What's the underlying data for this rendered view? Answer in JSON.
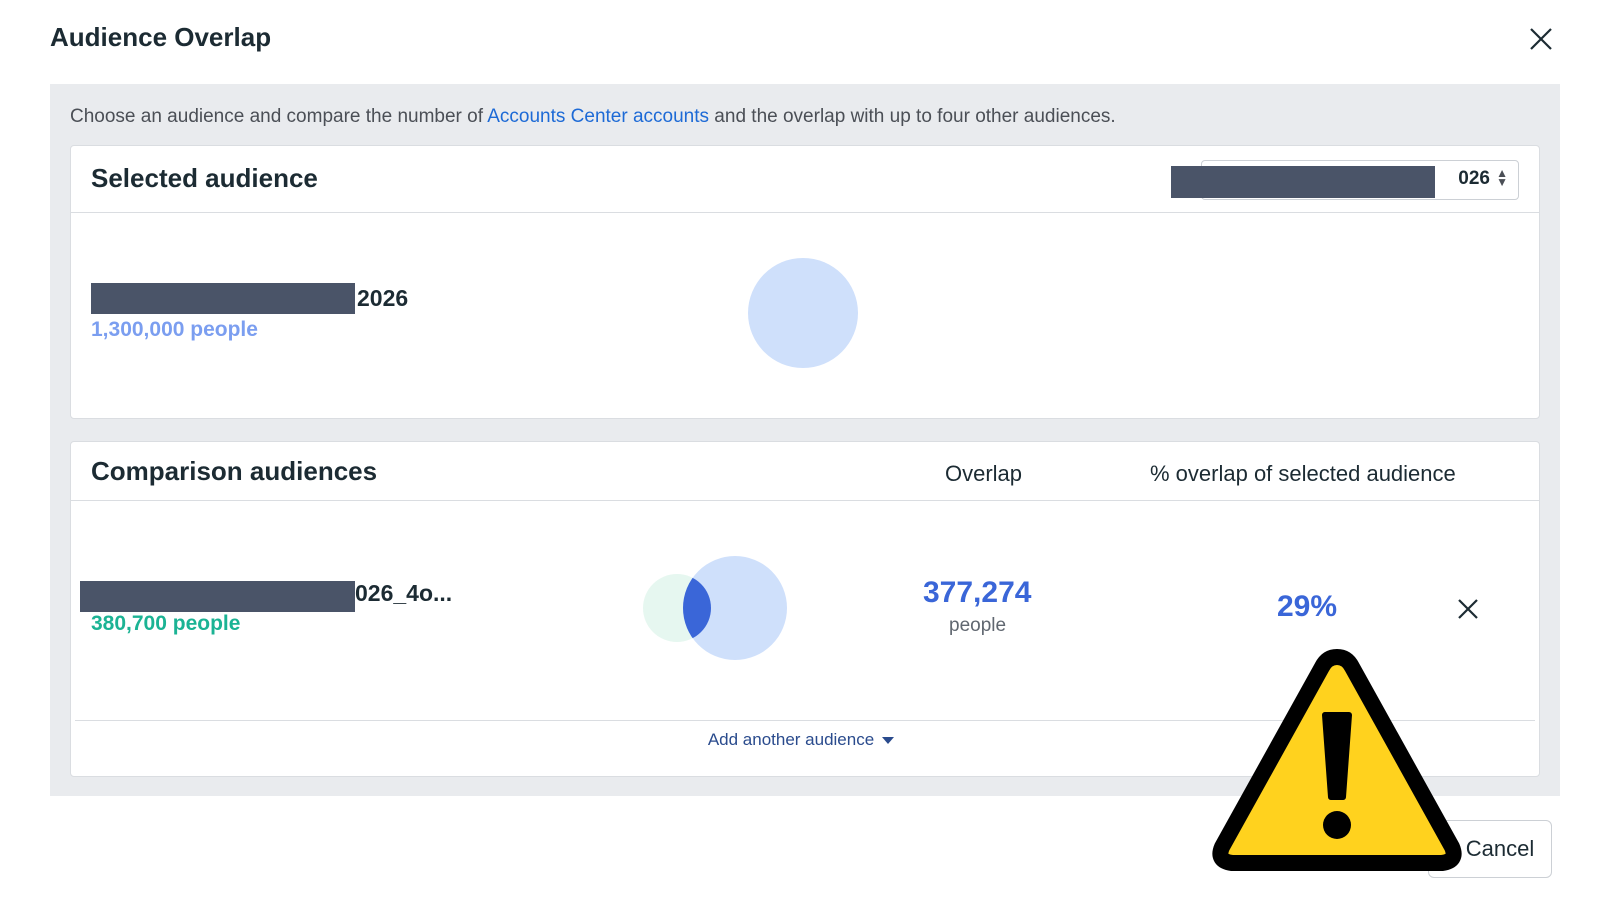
{
  "dialog": {
    "title": "Audience Overlap",
    "intro_prefix": "Choose an audience and compare the number of ",
    "intro_link": "Accounts Center accounts",
    "intro_suffix": " and the overlap with up to four other audiences."
  },
  "selected": {
    "heading": "Selected audience",
    "dropdown_value_visible": "026",
    "audience_name_visible": "2026",
    "audience_size": "1,300,000 people"
  },
  "comparison": {
    "heading": "Comparison audiences",
    "col_overlap": "Overlap",
    "col_percent": "% overlap of selected audience",
    "rows": [
      {
        "name_visible": "026_4o...",
        "size": "380,700 people",
        "overlap_value": "377,274",
        "overlap_unit": "people",
        "percent": "29%"
      }
    ],
    "add_link": "Add another audience"
  },
  "footer": {
    "cancel_label": "Cancel"
  },
  "colors": {
    "link": "#1d6ad6",
    "selected_size": "#7b9ef0",
    "comparison_size": "#1bb394",
    "overlap_number": "#3a66d8",
    "circle_selected": "#cfe0fb",
    "circle_comparison": "#e6f7f0",
    "circle_intersection": "#3a66d8",
    "redaction": "#4a5468",
    "warning_fill": "#ffd21e"
  },
  "icons": {
    "close": "close-icon",
    "dropdown": "sort-caret-icon",
    "remove_row": "remove-icon",
    "add_caret": "chevron-down-icon",
    "warning": "warning-triangle-icon"
  }
}
